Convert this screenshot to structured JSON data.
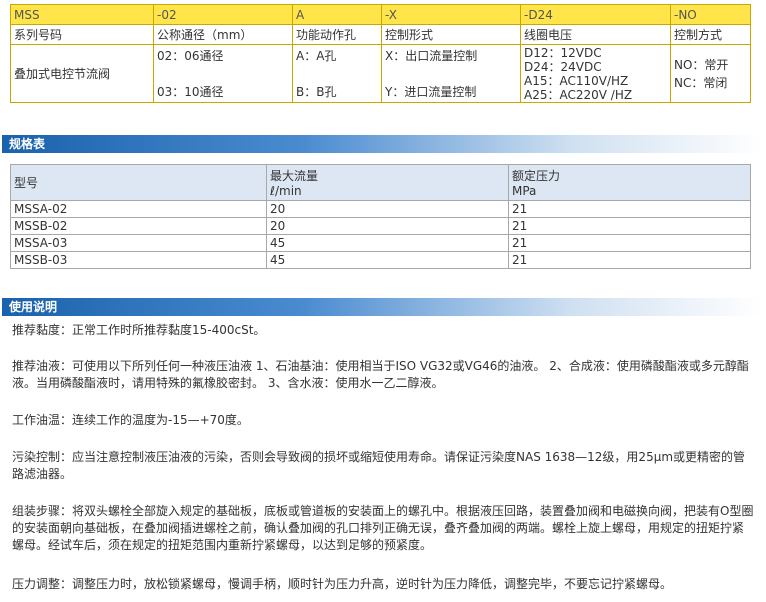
{
  "model_table": {
    "header": [
      "MSS",
      "-02",
      "A",
      "-X",
      "-D24",
      "-NO"
    ],
    "labels": [
      "系列号码",
      "公称通径（mm）",
      "功能动作孔",
      "控制形式",
      "线圈电压",
      "控制方式"
    ],
    "series_name": "叠加式电控节流阀",
    "diameter": [
      "02：06通径",
      "03：10通径"
    ],
    "port": [
      "A：A孔",
      "B：B孔"
    ],
    "control": [
      "X：出口流量控制",
      "Y：进口流量控制"
    ],
    "voltage": [
      "D12：12VDC",
      "D24：24VDC",
      "A15：AC110V/HZ",
      "A25：AC220V /HZ"
    ],
    "mode": [
      "NO：常开",
      "NC：常闭"
    ]
  },
  "spec_section": {
    "title": "规格表",
    "col_headers": [
      {
        "line1": "型号",
        "line2": ""
      },
      {
        "line1": "最大流量",
        "line2": "ℓ/min"
      },
      {
        "line1": "额定压力",
        "line2": "MPa"
      }
    ],
    "rows": [
      [
        "MSSA-02",
        "20",
        "21"
      ],
      [
        "MSSB-02",
        "20",
        "21"
      ],
      [
        "MSSA-03",
        "45",
        "21"
      ],
      [
        "MSSB-03",
        "45",
        "21"
      ]
    ]
  },
  "usage_section": {
    "title": "使用说明",
    "paragraphs": [
      "推荐黏度：正常工作时所推荐黏度15-400cSt。",
      "推荐油液：可使用以下所列任何一种液压油液 1、石油基油：使用相当于ISO VG32或VG46的油液。 2、合成液：使用磷酸酯液或多元醇酯液。当用磷酸酯液时，请用特殊的氟橡胶密封。 3、含水液：使用水一乙二醇液。",
      "工作油温：连续工作的温度为-15—+70度。",
      "污染控制：应当注意控制液压油液的污染，否则会导致阀的损坏或缩短使用寿命。请保证污染度NAS 1638—12级，用25μm或更精密的管路滤油器。",
      "组装步骤：将双头螺栓全部旋入规定的基础板，底板或管道板的安装面上的螺孔中。根据液压回路，装置叠加阀和电磁换向阀，把装有O型圈的安装面朝向基础板，在叠加阀插进螺栓之前，确认叠加阀的孔口排列正确无误，叠齐叠加阀的两端。螺栓上旋上螺母，用规定的扭矩拧紧螺母。经试车后，须在规定的扭矩范围内重新拧紧螺母，以达到足够的预紧度。",
      "压力调整：调整压力时，放松锁紧螺母，慢调手柄，顺时针为压力升高，逆时针为压力降低，调整完毕，不要忘记拧紧螺母。"
    ]
  }
}
